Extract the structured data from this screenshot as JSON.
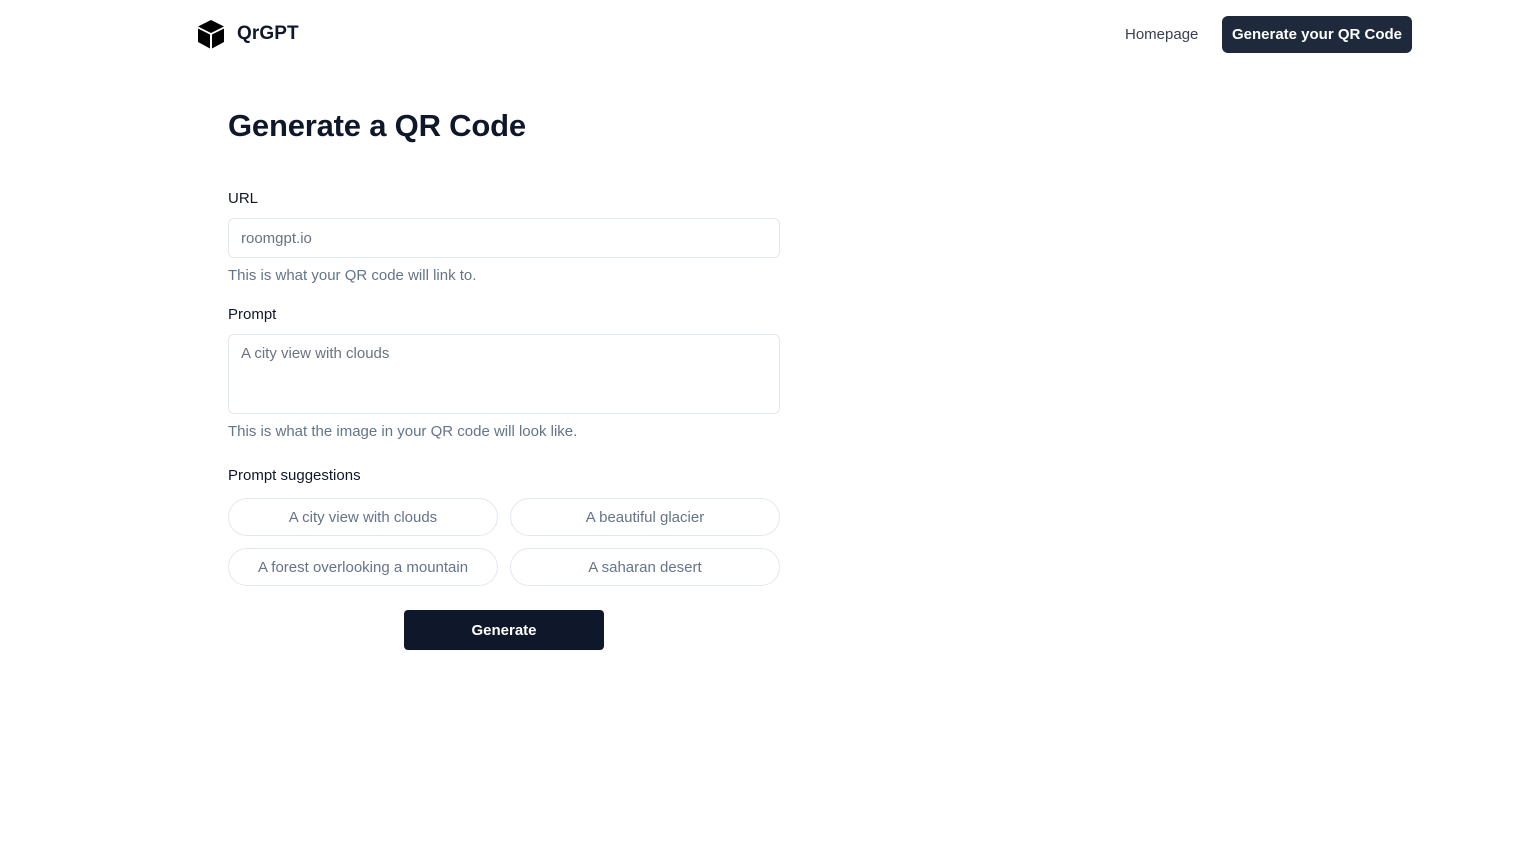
{
  "header": {
    "brand_name": "QrGPT",
    "brand_icon": "cube-icon",
    "nav_home": "Homepage",
    "nav_cta": "Generate your QR Code"
  },
  "main": {
    "title": "Generate a QR Code",
    "url_field": {
      "label": "URL",
      "value": "",
      "placeholder": "roomgpt.io",
      "help": "This is what your QR code will link to."
    },
    "prompt_field": {
      "label": "Prompt",
      "value": "",
      "placeholder": "A city view with clouds",
      "help": "This is what the image in your QR code will look like."
    },
    "suggestions": {
      "label": "Prompt suggestions",
      "items": [
        "A city view with clouds",
        "A beautiful glacier",
        "A forest overlooking a mountain",
        "A saharan desert"
      ]
    },
    "generate_label": "Generate"
  },
  "colors": {
    "primary_dark": "#0f172a",
    "cta_background": "#1e293b",
    "muted_text": "#64748b",
    "border": "#e2e8f0"
  }
}
